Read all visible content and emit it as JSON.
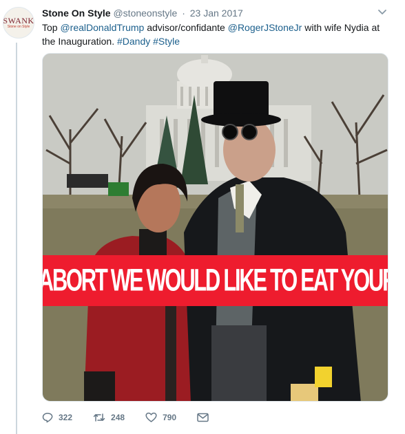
{
  "tweet": {
    "avatar": {
      "logo_text": "SWANK",
      "sub_text": "Stone on Style"
    },
    "author_name": "Stone On Style",
    "author_handle": "@stoneonstyle",
    "separator": "·",
    "date": "23 Jan 2017",
    "text_parts": {
      "t1": "Top ",
      "m1": "@realDonaldTrump",
      "t2": " advisor/confidante ",
      "m2": "@RogerJStoneJr",
      "t3": " with wife Nydia at the Inauguration. ",
      "h1": "#Dandy",
      "t4": " ",
      "h2": "#Style"
    },
    "media": {
      "banner_text": "DON'T ABORT WE WOULD LIKE TO EAT YOUR BABY",
      "banner_color": "#ee1c2e"
    },
    "actions": {
      "replies": "322",
      "retweets": "248",
      "likes": "790"
    },
    "link_color": "#1b5f8c"
  }
}
